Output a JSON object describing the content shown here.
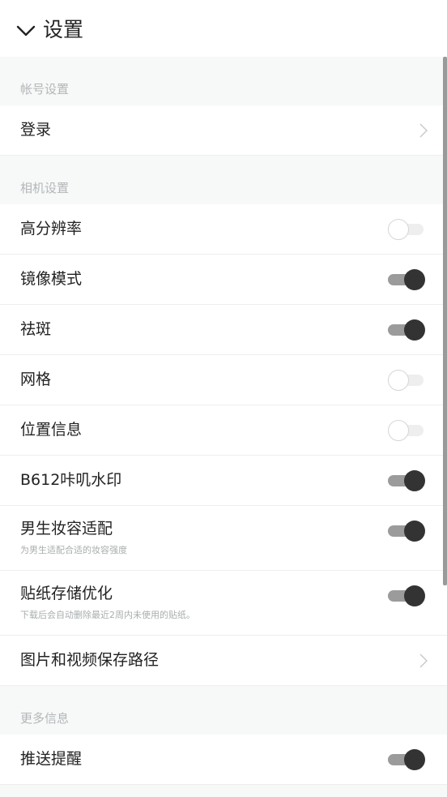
{
  "header": {
    "title": "设置",
    "back_icon": "chevron-down-icon"
  },
  "sections": {
    "account": {
      "title": "帐号设置",
      "login": {
        "label": "登录"
      }
    },
    "camera": {
      "title": "相机设置",
      "items": [
        {
          "label": "高分辨率",
          "on": false
        },
        {
          "label": "镜像模式",
          "on": true
        },
        {
          "label": "祛斑",
          "on": true
        },
        {
          "label": "网格",
          "on": false
        },
        {
          "label": "位置信息",
          "on": false
        },
        {
          "label": "B612咔叽水印",
          "on": true
        },
        {
          "label": "男生妆容适配",
          "sub": "为男生适配合适的妆容强度",
          "on": true
        },
        {
          "label": "贴纸存储优化",
          "sub": "下载后会自动删除最近2周内未使用的贴纸。",
          "on": true
        }
      ],
      "save_path": {
        "label": "图片和视频保存路径"
      }
    },
    "more": {
      "title": "更多信息",
      "push": {
        "label": "推送提醒",
        "on": true
      }
    }
  },
  "colors": {
    "toggle_on_knob": "#333333",
    "toggle_on_track": "#9b9b9b",
    "toggle_off_track": "#eeeeee",
    "section_text": "#b3b7b8",
    "background": "#f7f8f8"
  }
}
